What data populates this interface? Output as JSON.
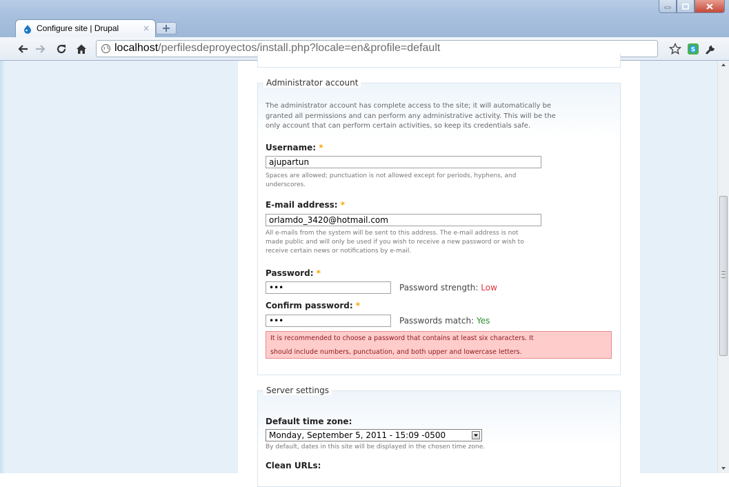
{
  "browser": {
    "tab_title": "Configure site | Drupal",
    "tab_close": "×",
    "url_host": "localhost",
    "url_path": "/perfilesdeproyectos/install.php?locale=en&profile=default"
  },
  "admin": {
    "legend": "Administrator account",
    "description_lines": [
      "The administrator account has complete access to the site; it will automatically be",
      "granted all permissions and can perform any administrative activity. This will be the",
      "only account that can perform certain activities, so keep its credentials safe."
    ],
    "username_label": "Username:",
    "username_value": "ajupartun",
    "username_help_lines": [
      "Spaces are allowed; punctuation is not allowed except for periods, hyphens, and",
      "underscores."
    ],
    "email_label": "E-mail address:",
    "email_value": "orlamdo_3420@hotmail.com",
    "email_help_lines": [
      "All e-mails from the system will be sent to this address. The e-mail address is not",
      "made public and will only be used if you wish to receive a new password or wish to",
      "receive certain news or notifications by e-mail."
    ],
    "password_label": "Password:",
    "password_value": "•••",
    "strength_label": "Password strength:",
    "strength_value": "Low",
    "confirm_label": "Confirm password:",
    "confirm_value": "•••",
    "match_label": "Passwords match:",
    "match_value": "Yes",
    "warning_lines": [
      "It is recommended to choose a password that contains at least six characters. It",
      "should include numbers, punctuation, and both upper and lowercase letters."
    ],
    "required_mark": "*"
  },
  "server": {
    "legend": "Server settings",
    "timezone_label": "Default time zone:",
    "timezone_value": "Monday, September 5, 2011 - 15:09 -0500",
    "timezone_help": "By default, dates in this site will be displayed in the chosen time zone.",
    "clean_urls_label": "Clean URLs:"
  },
  "colors": {
    "required": "#f7a600",
    "strength_low": "#e0343c",
    "match_yes": "#2a8f2a",
    "warning_bg": "#ffcccc",
    "page_bg": "#e6f0f9"
  },
  "icons": {
    "favicon": "drupal-drop-icon",
    "back": "back-arrow-icon",
    "forward": "forward-arrow-icon",
    "reload": "reload-icon",
    "home": "home-icon",
    "page": "page-globe-icon",
    "star": "star-icon",
    "extension": "skype-extension-icon",
    "wrench": "wrench-icon"
  }
}
